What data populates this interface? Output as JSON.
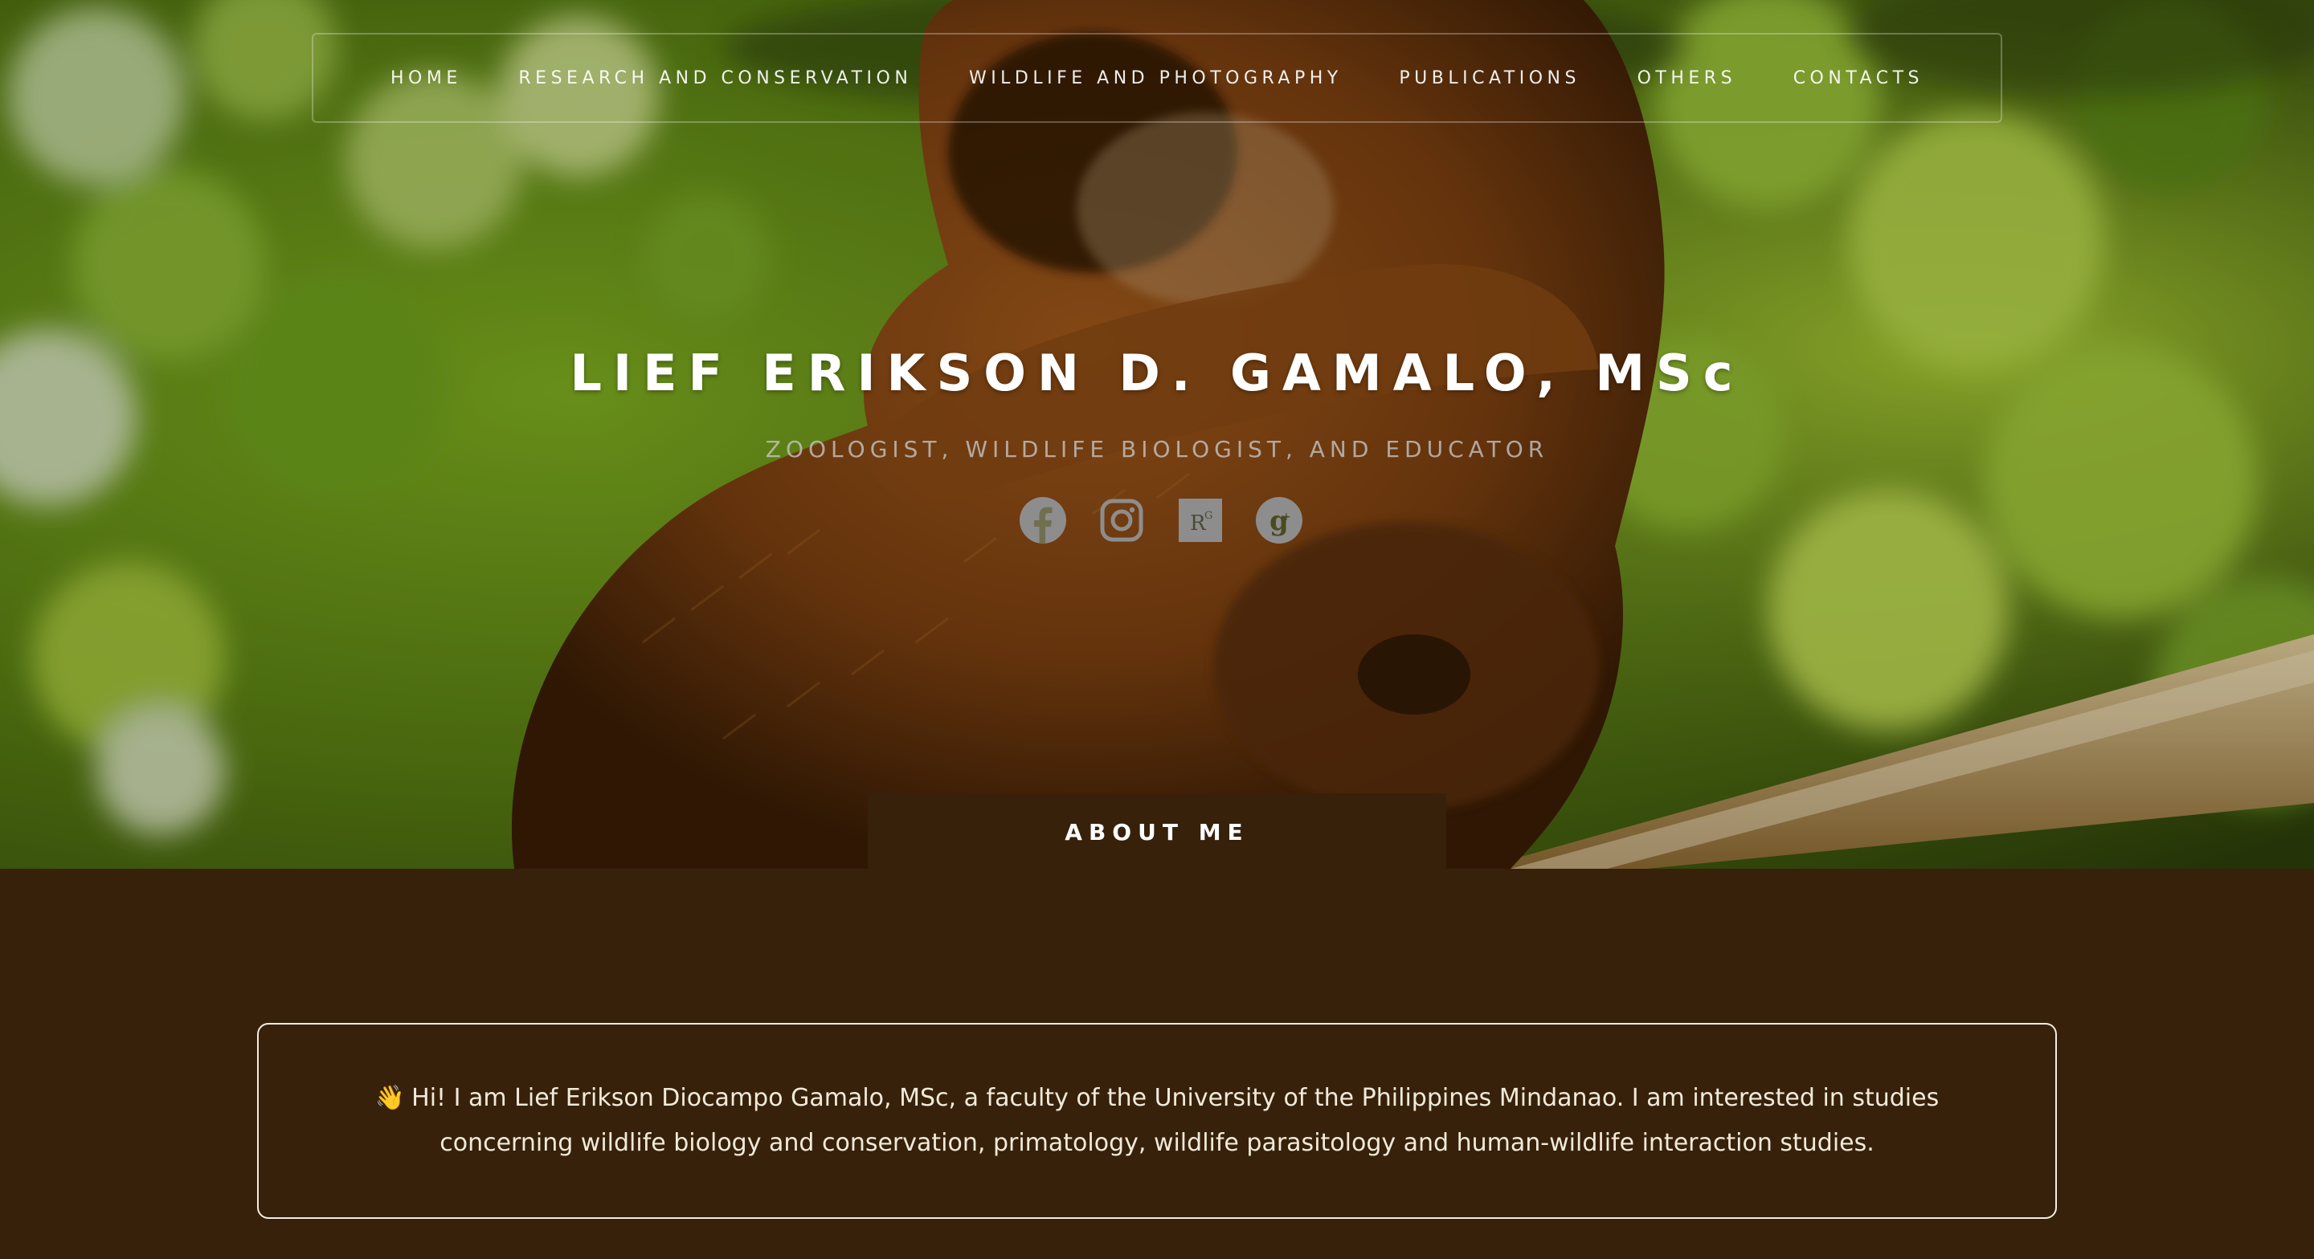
{
  "nav": {
    "items": [
      {
        "label": "HOME"
      },
      {
        "label": "RESEARCH AND CONSERVATION"
      },
      {
        "label": "WILDLIFE AND PHOTOGRAPHY"
      },
      {
        "label": "PUBLICATIONS"
      },
      {
        "label": "OTHERS"
      },
      {
        "label": "CONTACTS"
      }
    ]
  },
  "hero": {
    "title": "LIEF ERIKSON D. GAMALO, MSc",
    "subtitle": "ZOOLOGIST, WILDLIFE BIOLOGIST, AND EDUCATOR",
    "image": "brown monkey with infant on a branch, green foliage background",
    "socials": [
      {
        "icon": "facebook-icon"
      },
      {
        "icon": "instagram-icon"
      },
      {
        "icon": "researchgate-icon",
        "glyph": "R"
      },
      {
        "icon": "google-scholar-icon",
        "glyph": "g"
      }
    ]
  },
  "about": {
    "tab_label": "ABOUT ME",
    "wave_emoji": "👋",
    "intro": "Hi! I am Lief Erikson Diocampo Gamalo, MSc, a faculty of the University of the Philippines Mindanao. I am interested in studies concerning wildlife biology and conservation, primatology, wildlife parasitology and human-wildlife interaction studies."
  },
  "colors": {
    "brown_bg": "#37210a",
    "text_light": "#f1eadb",
    "foliage": "#6f9a1a"
  }
}
